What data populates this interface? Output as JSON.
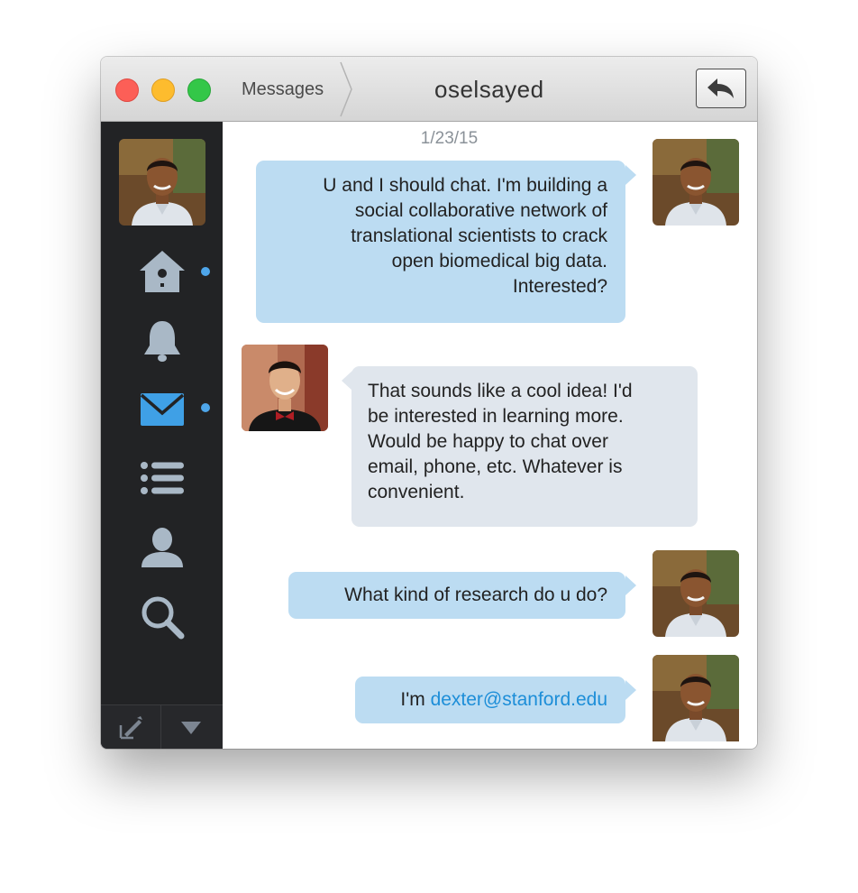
{
  "window": {
    "breadcrumb": "Messages",
    "title": "oselsayed"
  },
  "sidebar": {
    "items": [
      {
        "icon": "birdhouse-home-icon",
        "badge": true
      },
      {
        "icon": "bell-icon",
        "badge": false
      },
      {
        "icon": "envelope-icon",
        "badge": true,
        "active": true
      },
      {
        "icon": "list-icon",
        "badge": false
      },
      {
        "icon": "person-icon",
        "badge": false
      },
      {
        "icon": "search-icon",
        "badge": false
      }
    ],
    "footer": [
      "compose-icon",
      "dropdown-triangle-icon"
    ]
  },
  "colors": {
    "accent": "#4ea6ea",
    "outgoing_bubble": "#bcdcf2",
    "incoming_bubble": "#e0e6ed",
    "sidebar": "#222325",
    "link": "#1d8ed8"
  },
  "conversation": {
    "date": "1/23/15",
    "messages": [
      {
        "direction": "out",
        "lines": [
          "U and I should chat. I'm building a",
          "social collaborative network of",
          "translational scientists to crack",
          "open biomedical big data.",
          "Interested?"
        ]
      },
      {
        "direction": "in",
        "lines": [
          "That sounds like a cool idea! I'd",
          "be interested in learning more.",
          "Would be happy to chat over",
          "email, phone, etc. Whatever is",
          "convenient."
        ]
      },
      {
        "direction": "out",
        "text": "What kind of research do u do?"
      },
      {
        "direction": "out",
        "prefix": "I'm ",
        "link": "dexter@stanford.edu"
      }
    ]
  }
}
